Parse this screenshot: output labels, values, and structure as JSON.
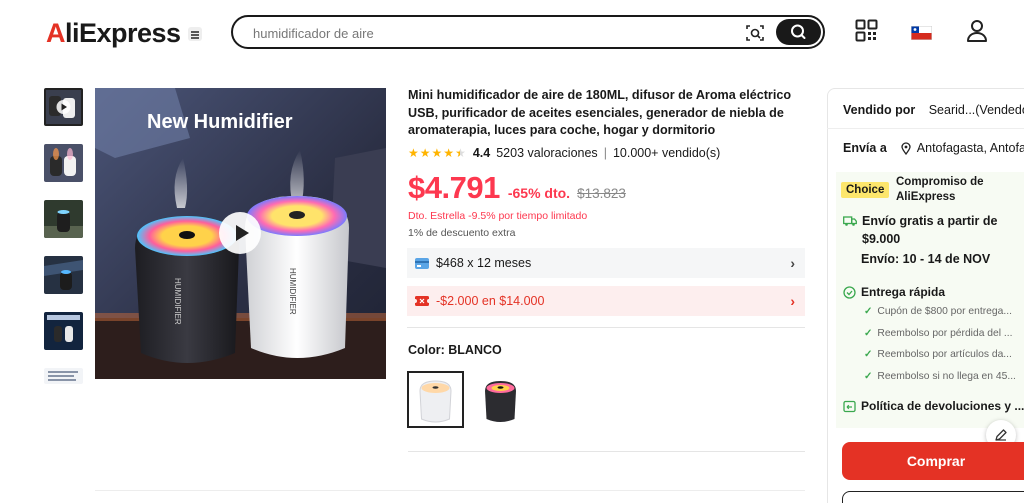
{
  "header": {
    "logo_prefix": "A",
    "logo_rest": "liExpress",
    "search_value": "",
    "search_placeholder": "humidificador de aire"
  },
  "product": {
    "title": "Mini humidificador de aire de 180ML, difusor de Aroma eléctrico USB, purificador de aceites esenciales, generador de niebla de aromaterapia, luces para coche, hogar y dormitorio",
    "rating": "4.4",
    "rating_value": 4.4,
    "reviews": "5203 valoraciones",
    "sold": "10.000+ vendido(s)",
    "main_image_caption": "New Humidifier",
    "product_label": "HUMIDIFIER",
    "price": "$4.791",
    "discount": "-65% dto.",
    "original_price": "$13.823",
    "promo_star": "Dto. Estrella -9.5% por tiempo limitado",
    "promo_extra": "1% de descuento extra",
    "installments": "$468 x 12 meses",
    "coupon": "-$2.000 en $14.000",
    "color_label": "Color: BLANCO"
  },
  "panel": {
    "seller_label": "Vendido por",
    "seller_value": "Searid...(Vendedor",
    "ship_label": "Envía a",
    "ship_value": "Antofagasta, Antofa",
    "choice_tag": "Choice",
    "choice_title": "Compromiso de AliExpress",
    "free_ship_line1": "Envío gratis a partir de",
    "free_ship_line2": "$9.000",
    "delivery": "Envío: 10 - 14 de NOV",
    "fast": "Entrega rápida",
    "bullets": [
      "Cupón de $800 por entrega...",
      "Reembolso por pérdida del ...",
      "Reembolso por artículos da...",
      "Reembolso si no llega en 45..."
    ],
    "returns": "Política de devoluciones y ...",
    "buy": "Comprar"
  },
  "colors": {
    "accent": "#e43225",
    "price": "#fd384f",
    "choice_yellow": "#fde66c"
  }
}
